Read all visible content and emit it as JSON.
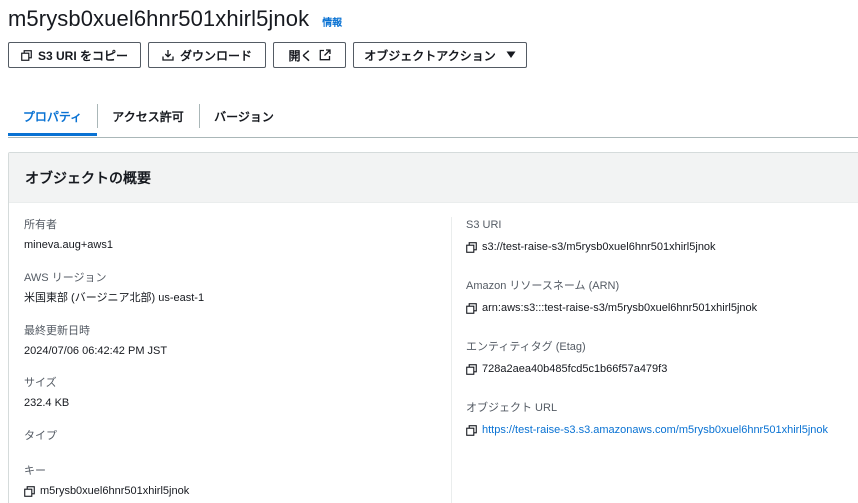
{
  "object": {
    "name": "m5rysb0xuel6hnr501xhirl5jnok",
    "info_label": "情報"
  },
  "actions": {
    "copy_s3_uri": "S3 URI をコピー",
    "download": "ダウンロード",
    "open": "開く",
    "object_actions": "オブジェクトアクション"
  },
  "tabs": [
    {
      "label": "プロパティ",
      "active": true
    },
    {
      "label": "アクセス許可",
      "active": false
    },
    {
      "label": "バージョン",
      "active": false
    }
  ],
  "overview": {
    "title": "オブジェクトの概要",
    "left": [
      {
        "label": "所有者",
        "value": "mineva.aug+aws1"
      },
      {
        "label": "AWS リージョン",
        "value": "米国東部 (バージニア北部) us-east-1"
      },
      {
        "label": "最終更新日時",
        "value": "2024/07/06 06:42:42 PM JST"
      },
      {
        "label": "サイズ",
        "value": "232.4 KB"
      },
      {
        "label": "タイプ",
        "value": ""
      },
      {
        "label": "キー",
        "value": "m5rysb0xuel6hnr501xhirl5jnok"
      }
    ],
    "right": [
      {
        "label": "S3 URI",
        "value": "s3://test-raise-s3/m5rysb0xuel6hnr501xhirl5jnok"
      },
      {
        "label": "Amazon リソースネーム (ARN)",
        "value": "arn:aws:s3:::test-raise-s3/m5rysb0xuel6hnr501xhirl5jnok"
      },
      {
        "label": "エンティティタグ (Etag)",
        "value": "728a2aea40b485fcd5c1b66f57a479f3"
      },
      {
        "label": "オブジェクト URL",
        "value": "https://test-raise-s3.s3.amazonaws.com/m5rysb0xuel6hnr501xhirl5jnok"
      }
    ]
  },
  "colors": {
    "link": "#0972d3",
    "text": "#16191f",
    "muted": "#545b64"
  }
}
